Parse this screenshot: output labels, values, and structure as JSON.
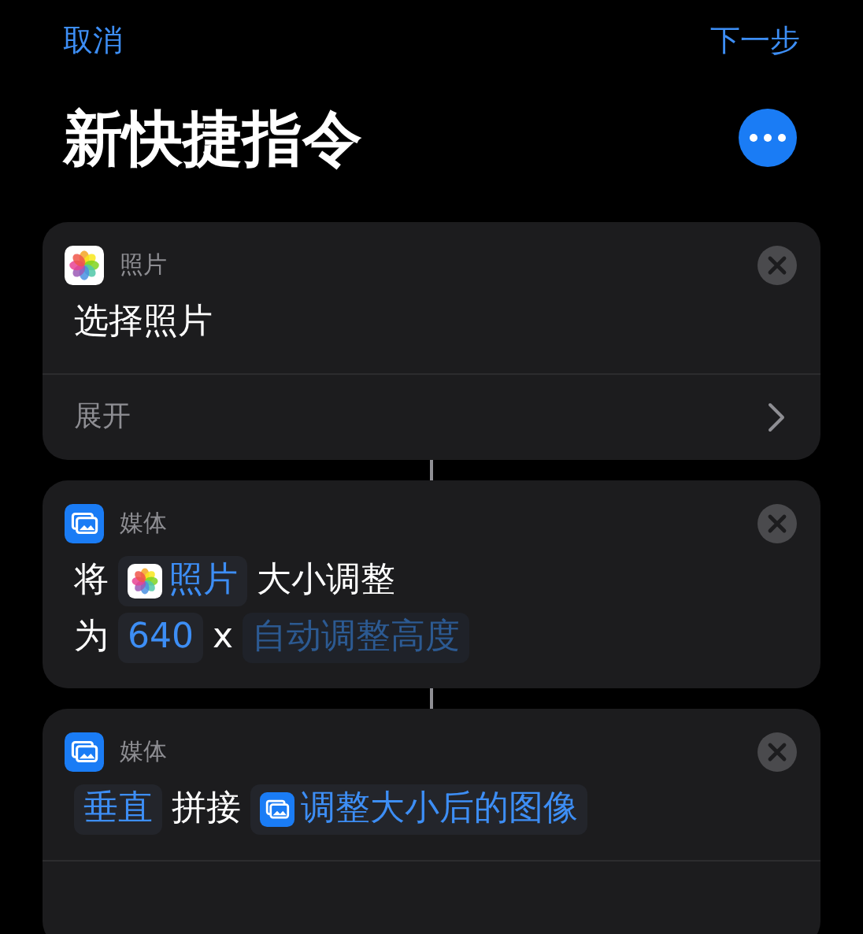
{
  "nav": {
    "cancel": "取消",
    "next": "下一步"
  },
  "title": "新快捷指令",
  "actions": [
    {
      "app": {
        "kind": "photos",
        "label": "照片"
      },
      "lines": [
        [
          {
            "kind": "text",
            "text": "选择照片"
          }
        ]
      ],
      "expand": "展开"
    },
    {
      "app": {
        "kind": "media",
        "label": "媒体"
      },
      "lines": [
        [
          {
            "kind": "text",
            "text": "将"
          },
          {
            "kind": "param_photos",
            "text": "照片"
          },
          {
            "kind": "text",
            "text": "大小调整"
          }
        ],
        [
          {
            "kind": "text",
            "text": "为"
          },
          {
            "kind": "param",
            "text": "640"
          },
          {
            "kind": "text",
            "text": "x"
          },
          {
            "kind": "placeholder",
            "text": "自动调整高度"
          }
        ]
      ]
    },
    {
      "app": {
        "kind": "media",
        "label": "媒体"
      },
      "lines": [
        [
          {
            "kind": "param",
            "text": "垂直"
          },
          {
            "kind": "text",
            "text": "拼接"
          },
          {
            "kind": "param_media",
            "text": "调整大小后的图像"
          }
        ]
      ]
    }
  ]
}
